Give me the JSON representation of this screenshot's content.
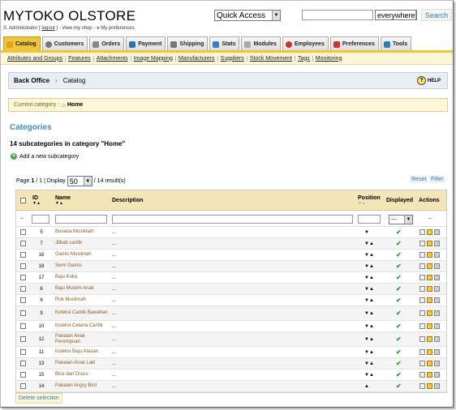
{
  "header": {
    "shop_title": "MYTOKO OLSTORE",
    "user": "S. Administrator",
    "logout": "logout",
    "view_shop": "View my shop",
    "preferences": "My preferences",
    "quick_access": "Quick Access",
    "search_where": "everywhere",
    "search_label": "Search"
  },
  "tabs": [
    {
      "label": "Catalog",
      "color": "#e0a020"
    },
    {
      "label": "Customers",
      "color": "#666"
    },
    {
      "label": "Orders",
      "color": "#666"
    },
    {
      "label": "Payment",
      "color": "#2a6fb0"
    },
    {
      "label": "Shipping",
      "color": "#666"
    },
    {
      "label": "Stats",
      "color": "#3a7fc0"
    },
    {
      "label": "Modules",
      "color": "#999"
    },
    {
      "label": "Employees",
      "color": "#c33"
    },
    {
      "label": "Preferences",
      "color": "#c33"
    },
    {
      "label": "Tools",
      "color": "#2a7fc1"
    }
  ],
  "subtabs": [
    "Attributes and Groups",
    "Features",
    "Attachments",
    "Image Mapping",
    "Manufacturers",
    "Suppliers",
    "Stock Movement",
    "Tags",
    "Monitoring"
  ],
  "breadcrumb": {
    "root": "Back Office",
    "current": "Catalog",
    "help": "HELP"
  },
  "current_category": {
    "label": "Current category :",
    "value": "Home"
  },
  "categories_title": "Categories",
  "subcategory_count": "14 subcategories in category \"Home\"",
  "add_subcategory": "Add a new subcategory",
  "pager": {
    "page_label": "Page",
    "page": "1",
    "total_pages": "/ 1",
    "display_label": "| Display",
    "per_page": "50",
    "results": "/ 14 result(s)"
  },
  "filters": {
    "reset": "Reset",
    "filter": "Filter",
    "displayed_select": "---",
    "dash": "--"
  },
  "columns": {
    "id": "ID",
    "name": "Name",
    "description": "Description",
    "position": "Position",
    "displayed": "Displayed",
    "actions": "Actions"
  },
  "rows": [
    {
      "id": "5",
      "name": "Busana Muslimah",
      "desc": "...",
      "pos": "down"
    },
    {
      "id": "7",
      "name": "Jilbab cantik",
      "desc": "...",
      "pos": "both"
    },
    {
      "id": "16",
      "name": "Gamis Muslimah",
      "desc": "...",
      "pos": "both"
    },
    {
      "id": "18",
      "name": "Semi Gamis",
      "desc": "...",
      "pos": "both"
    },
    {
      "id": "17",
      "name": "Baju Koko",
      "desc": "...",
      "pos": "both"
    },
    {
      "id": "6",
      "name": "Baju Muslim Anak",
      "desc": "...",
      "pos": "both"
    },
    {
      "id": "8",
      "name": "Rok Muslimah",
      "desc": "...",
      "pos": "both"
    },
    {
      "id": "9",
      "name": "Koleksi Cantik Bawahan",
      "desc": "...",
      "pos": "both"
    },
    {
      "id": "10",
      "name": "Koleksi Celana Cantik",
      "desc": "...",
      "pos": "both"
    },
    {
      "id": "12",
      "name": "Pakaian Anak Perempuan",
      "desc": "...",
      "pos": "both"
    },
    {
      "id": "11",
      "name": "Koleksi Baju Atasan",
      "desc": "...",
      "pos": "both"
    },
    {
      "id": "13",
      "name": "Pakaian Anak Laki",
      "desc": "...",
      "pos": "both"
    },
    {
      "id": "15",
      "name": "Blus dan Dress",
      "desc": "...",
      "pos": "both"
    },
    {
      "id": "14",
      "name": "Pakaian Angry Bird",
      "desc": "...",
      "pos": "up"
    }
  ],
  "delete_selection": "Delete selection"
}
